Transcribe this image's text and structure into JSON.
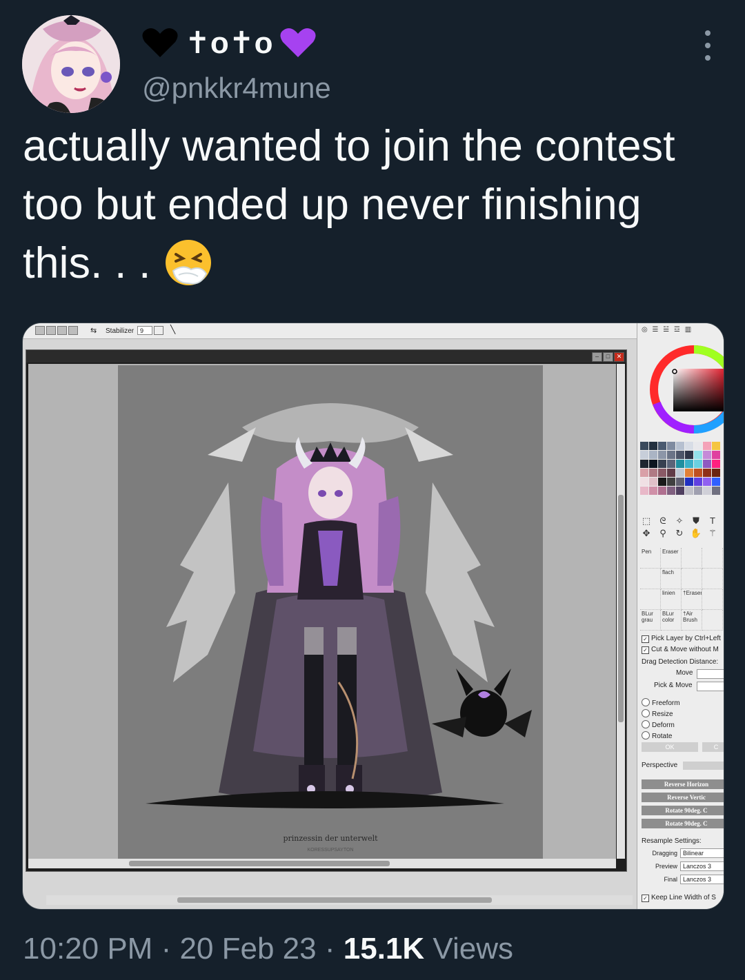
{
  "tweet": {
    "display_name": "✝o✝o",
    "name_prefix_icon": "black-heart",
    "name_suffix_icon": "purple-heart",
    "handle": "@pnkkr4mune",
    "text": "actually wanted to join the contest too but ended up never finishing this. . .",
    "emoji": "sneezing-face",
    "time": "10:20 PM",
    "date": "20 Feb 23",
    "separator": "·",
    "views_count": "15.1K",
    "views_label": "Views"
  },
  "paint_app": {
    "stabilizer_label": "Stabilizer",
    "stabilizer_value": "9",
    "artwork_caption": "prinzessin der unterwelt",
    "artwork_subcaption": "KORESSUPSAYTON",
    "brushes": [
      "Pen",
      "Eraser",
      "",
      "",
      "",
      "flach",
      "",
      "",
      "",
      "linien",
      "†Eraser",
      "",
      "BLur",
      "BLur",
      "†Air",
      ""
    ],
    "brush_sublabels": [
      "grau",
      "color",
      "Brush"
    ],
    "options": {
      "pick_layer": "Pick Layer by Ctrl+Left",
      "cut_move": "Cut & Move without M",
      "drag_detection": "Drag Detection Distance:",
      "move": "Move",
      "pick_move": "Pick & Move",
      "freeform": "Freeform",
      "resize": "Resize",
      "deform": "Deform",
      "rotate": "Rotate",
      "ok": "OK",
      "cancel": "C",
      "perspective": "Perspective",
      "reverse_h": "Reverse Horizon",
      "reverse_v": "Reverse Vertic",
      "rotate_ccw": "Rotate 90deg. C",
      "rotate_cw": "Rotate 90deg. C",
      "resample": "Resample Settings:",
      "dragging_label": "Dragging",
      "dragging_value": "Bilinear",
      "preview_label": "Preview",
      "preview_value": "Lanczos 3",
      "final_label": "Final",
      "final_value": "Lanczos 3",
      "keep_line": "Keep Line Width of S"
    },
    "palette": [
      "#3b4a5c",
      "#23303f",
      "#4a5a70",
      "#7f8ba0",
      "#b6c0d0",
      "#d8dde6",
      "#e8e8ec",
      "#f4a2b8",
      "#f5c542",
      "#c7ced9",
      "#aab4c4",
      "#8c96a8",
      "#6b7487",
      "#4d5568",
      "#2f3547",
      "#93e0e8",
      "#c58ad8",
      "#e040a0",
      "#1e2530",
      "#0d1520",
      "#374050",
      "#5a6478",
      "#1f8fa0",
      "#3bb0c8",
      "#6ad0e0",
      "#8f5ac0",
      "#ff2080",
      "#d9a0a8",
      "#b07a84",
      "#8a5a66",
      "#603c48",
      "#bfc8d4",
      "#e08038",
      "#c05020",
      "#903018",
      "#6a2410",
      "#f0e0e4",
      "#e0c0c8",
      "#1a1a1a",
      "#404040",
      "#606070",
      "#2030c0",
      "#6040e0",
      "#9060f0",
      "#3060ff",
      "#e8b8c8",
      "#d090a8",
      "#b07090",
      "#806080",
      "#504060",
      "#c0c0c8",
      "#a0a0b0",
      "#d0d0d8",
      "#707080"
    ]
  }
}
